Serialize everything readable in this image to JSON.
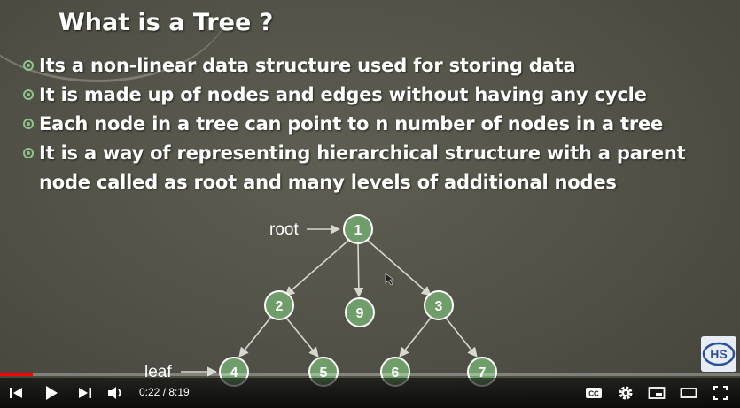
{
  "slide": {
    "title": "What is a Tree ?",
    "bullets": [
      "Its a non-linear data structure used for storing data",
      "It is made up of nodes and edges without having any cycle",
      "Each node in a tree can point to n number of nodes in a tree",
      "It is a way of representing hierarchical structure with a parent",
      "node called as root and many levels of additional nodes"
    ],
    "diagram": {
      "root_label": "root",
      "leaf_label": "leaf",
      "nodes": [
        "1",
        "2",
        "9",
        "3",
        "4",
        "5",
        "6",
        "7"
      ]
    },
    "logo_text": "HS"
  },
  "player": {
    "current_time": "0:22",
    "separator": " / ",
    "duration": "8:19",
    "progress": 0.044,
    "buttons": [
      "previous-icon",
      "play-icon",
      "next-icon",
      "volume-icon",
      "cc-icon",
      "settings-icon",
      "miniplayer-icon",
      "theater-icon",
      "fullscreen-icon"
    ],
    "cc_label": "CC"
  },
  "colors": {
    "node_fill": "#6f9e6b",
    "node_border": "#ffffff",
    "edge": "#d8d8d0",
    "bullet": "#8fc38c",
    "progress": "#ff0000"
  }
}
